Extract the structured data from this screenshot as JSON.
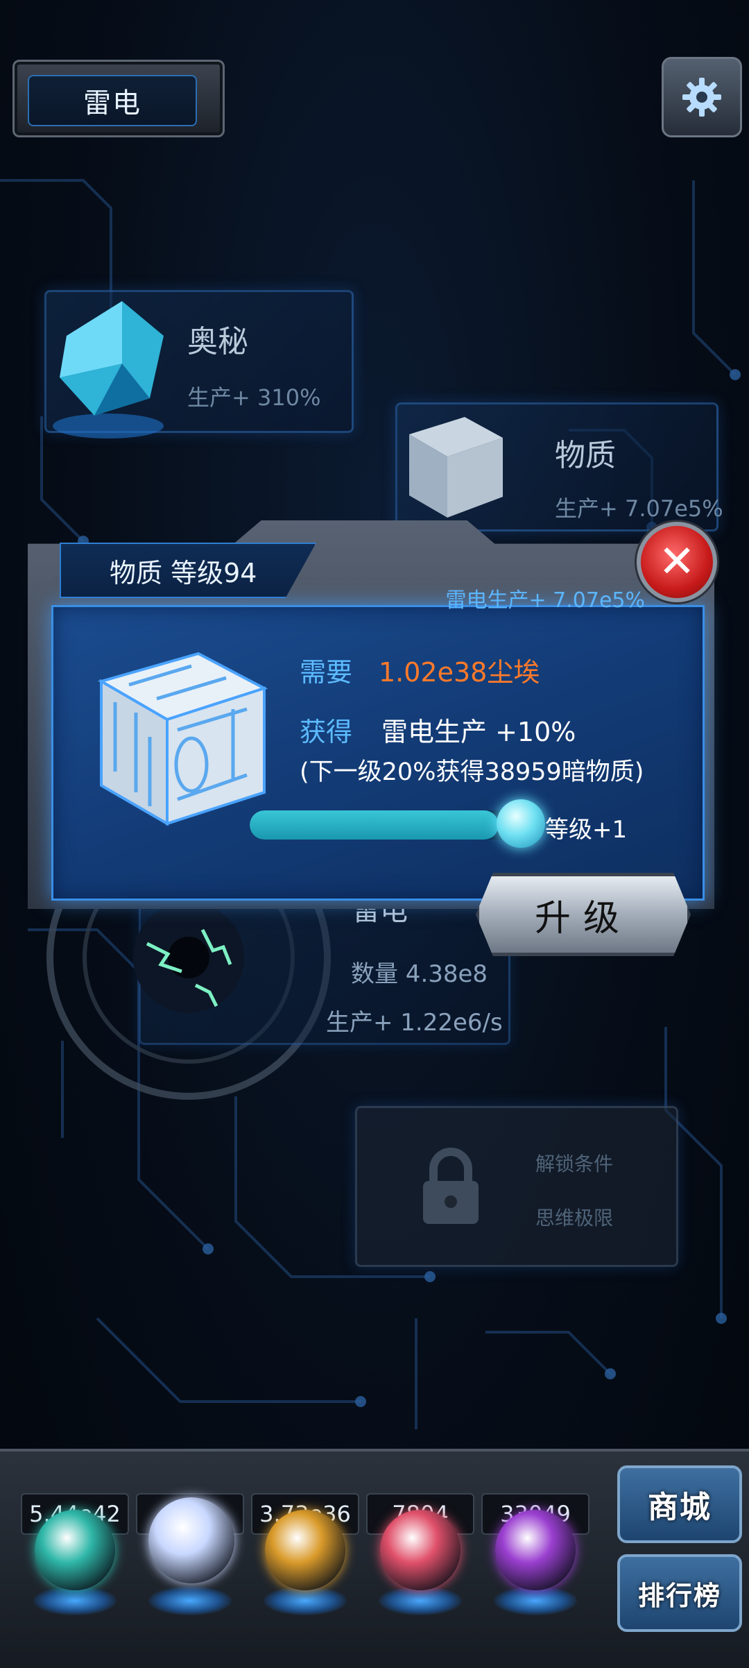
{
  "header": {
    "title": "雷电"
  },
  "cards": {
    "mystery": {
      "title": "奥秘",
      "production": "生产+ 310%"
    },
    "matter": {
      "title": "物质",
      "production": "生产+ 7.07e5%"
    },
    "lightning": {
      "title": "雷电",
      "count": "数量 4.38e8",
      "production": "生产+ 1.22e6/s"
    },
    "locked": {
      "condition_label": "解锁条件",
      "requirement": "思维极限"
    }
  },
  "modal": {
    "title": "物质 等级94",
    "subtitle": "雷电生产+ 7.07e5%",
    "need_label": "需要",
    "need_value": "1.02e38尘埃",
    "gain_label": "获得",
    "gain_value": "雷电生产 +10%",
    "next_level_text": "(下一级20%获得38959暗物质)",
    "progress_fraction": 0.92,
    "level_increment": "等级+1",
    "upgrade_label": "升级"
  },
  "resources": [
    {
      "value": "5.44e42",
      "color": "#2fb7a8"
    },
    {
      "value": "8",
      "color": "#c9d8ff"
    },
    {
      "value": "3.73e36",
      "color": "#d99a2a"
    },
    {
      "value": "7804",
      "color": "#e0506a"
    },
    {
      "value": "33049",
      "color": "#9a3fd0"
    }
  ],
  "side_buttons": {
    "shop": "商城",
    "ranking": "排行榜"
  }
}
